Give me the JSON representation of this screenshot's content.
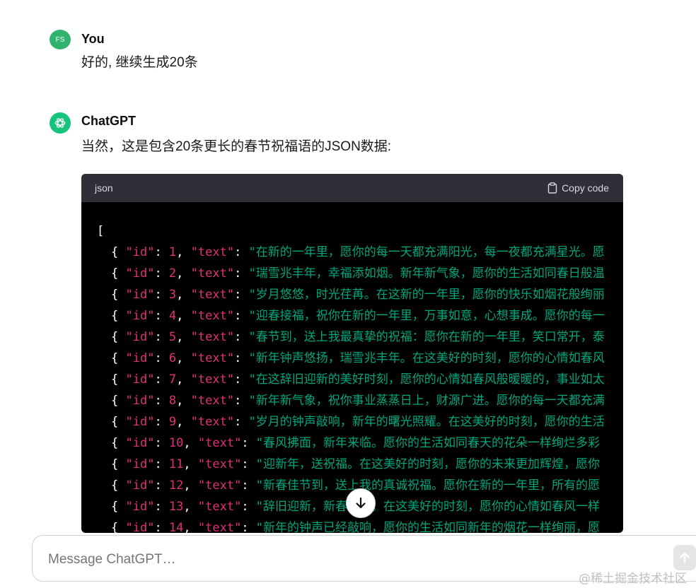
{
  "conversation": {
    "user_message": {
      "avatar_initials": "FS",
      "author": "You",
      "text": "好的, 继续生成20条"
    },
    "assistant_message": {
      "author": "ChatGPT",
      "intro": "当然，这是包含20条更长的春节祝福语的JSON数据:",
      "code_block": {
        "language": "json",
        "copy_label": "Copy code",
        "open_bracket": "[",
        "lines": [
          {
            "id": "1",
            "text": "\"在新的一年里，愿你的每一天都充满阳光，每一夜都充满星光。愿"
          },
          {
            "id": "2",
            "text": "\"瑞雪兆丰年，幸福添如烟。新年新气象，愿你的生活如同春日般温"
          },
          {
            "id": "3",
            "text": "\"岁月悠悠，时光荏苒。在这新的一年里，愿你的快乐如烟花般绚丽"
          },
          {
            "id": "4",
            "text": "\"迎春接福，祝你在新的一年里，万事如意，心想事成。愿你的每一"
          },
          {
            "id": "5",
            "text": "\"春节到，送上我最真挚的祝福：愿你在新的一年里，笑口常开，泰"
          },
          {
            "id": "6",
            "text": "\"新年钟声悠扬，瑞雪兆丰年。在这美好的时刻，愿你的心情如春风"
          },
          {
            "id": "7",
            "text": "\"在这辞旧迎新的美好时刻，愿你的心情如春风般暖暖的，事业如太"
          },
          {
            "id": "8",
            "text": "\"新年新气象，祝你事业蒸蒸日上，财源广进。愿你的每一天都充满"
          },
          {
            "id": "9",
            "text": "\"岁月的钟声敲响，新年的曙光照耀。在这美好的时刻，愿你的生活"
          },
          {
            "id": "10",
            "text": "\"春风拂面，新年来临。愿你的生活如同春天的花朵一样绚烂多彩"
          },
          {
            "id": "11",
            "text": "\"迎新年，送祝福。在这美好的时刻，愿你的未来更加辉煌，愿你"
          },
          {
            "id": "12",
            "text": "\"新春佳节到，送上我的真诚祝福。愿你在新的一年里，所有的愿"
          },
          {
            "id": "13",
            "text": "\"辞旧迎新，新春将至。在这美好的时刻，愿你的心情如春风一样"
          },
          {
            "id": "14",
            "text": "\"新年的钟声已经敲响，愿你的生活如同新年的烟花一样绚丽，愿"
          }
        ]
      }
    }
  },
  "composer": {
    "placeholder": "Message ChatGPT…"
  },
  "watermark": "@稀土掘金技术社区",
  "colors": {
    "user_avatar": "#2fb36e",
    "assistant_avatar": "#19c37d",
    "code_key": "#df3079",
    "code_string": "#00a67d",
    "code_bg": "#000000",
    "code_header_bg": "#2f2f37"
  }
}
